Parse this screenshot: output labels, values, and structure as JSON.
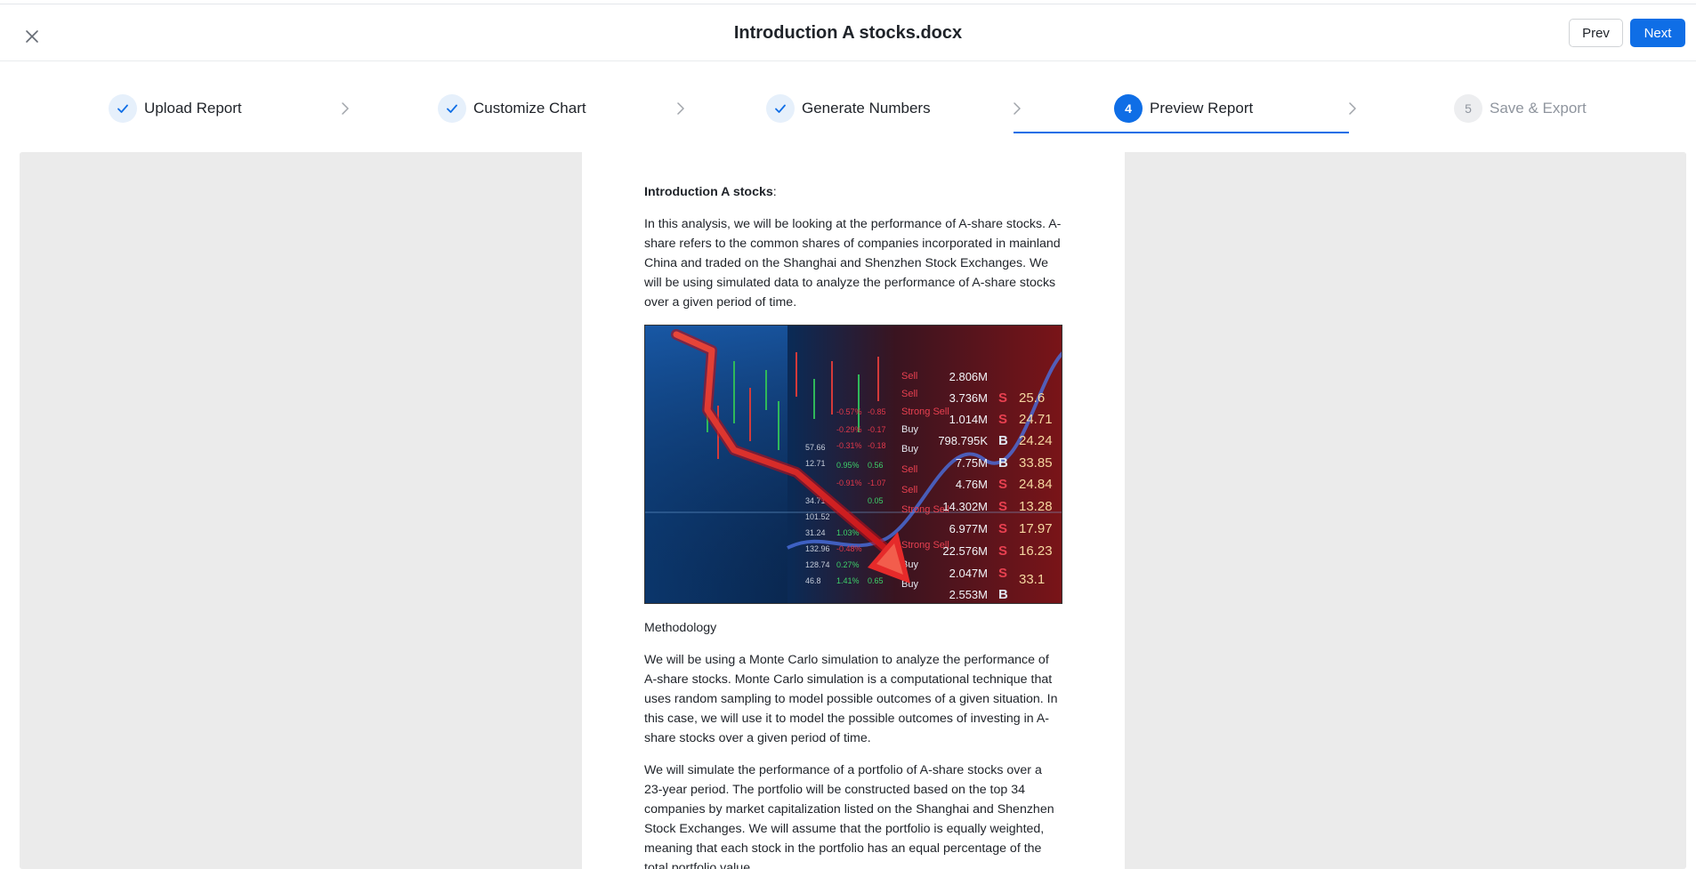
{
  "header": {
    "title": "Introduction A stocks.docx",
    "prev_label": "Prev",
    "next_label": "Next"
  },
  "steps": [
    {
      "label": "Upload Report",
      "state": "done"
    },
    {
      "label": "Customize Chart",
      "state": "done"
    },
    {
      "label": "Generate Numbers",
      "state": "done"
    },
    {
      "label": "Preview Report",
      "state": "active",
      "number": "4"
    },
    {
      "label": "Save & Export",
      "state": "future",
      "number": "5"
    }
  ],
  "document": {
    "intro_title": "Introduction A stocks",
    "intro_colon": ":",
    "para1": "In this analysis, we will be looking at the performance of A-share stocks. A-share refers to the common shares of companies incorporated in mainland China and traded on the Shanghai and Shenzhen Stock Exchanges. We will be using simulated data to analyze the performance of A-share stocks over a given period of time.",
    "methodology": "Methodology",
    "para2": "We will be using a Monte Carlo simulation to analyze the performance of A-share stocks. Monte Carlo simulation is a computational technique that uses random sampling to model possible outcomes of a given situation. In this case, we will use it to model the possible outcomes of investing in A-share stocks over a given period of time.",
    "para3": "We will simulate the performance of a portfolio of A-share stocks over a 23-year period. The portfolio will be constructed based on the top 34 companies by market capitalization listed on the Shanghai and Shenzhen Stock Exchanges. We will assume that the portfolio is equally weighted, meaning that each stock in the portfolio has an equal percentage of the total portfolio value."
  },
  "figure_board": {
    "volumes": [
      "2.806M",
      "3.736M",
      "1.014M",
      "798.795K",
      "7.75M",
      "4.76M",
      "14.302M",
      "6.977M",
      "22.576M",
      "2.047M",
      "2.553M"
    ],
    "flags": [
      "S",
      "S",
      "B",
      "B",
      "S",
      "S",
      "S",
      "S",
      "S",
      "B",
      "B"
    ],
    "prices": [
      "25.6",
      "24.71",
      "24.24",
      "33.85",
      "24.84",
      "13.28",
      "17.97",
      "16.23",
      "33.1"
    ],
    "actions": [
      "Sell",
      "Sell",
      "Strong Sell",
      "Buy",
      "Buy",
      "Sell",
      "Sell",
      "Strong Sell",
      "Strong Sell",
      "Buy",
      "Buy"
    ]
  },
  "colors": {
    "accent": "#0f6ee6",
    "done_circle": "#e6f0fb",
    "preview_bg": "#ebebeb"
  },
  "icons": {
    "close": "close-icon",
    "check": "check-icon",
    "chevron": "chevron-right-icon"
  }
}
